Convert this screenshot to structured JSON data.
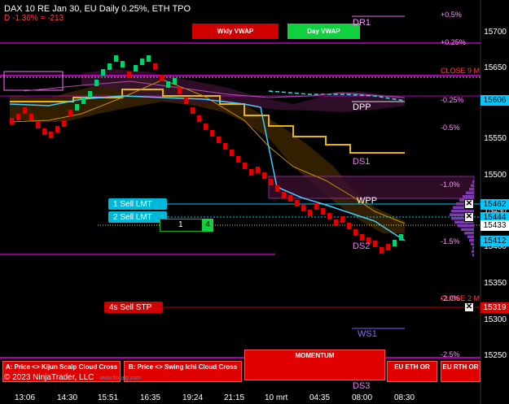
{
  "header": {
    "title": "DAX 10  RE Jan 30, EU Daily 0.25%, ETH TPO",
    "change": "D -1.36% = -213"
  },
  "vwap_buttons": {
    "weekly": "Wkly VWAP",
    "daily": "Day VWAP"
  },
  "level_labels": {
    "dr1": "DR1",
    "close_9m": "CLOSE 9 M",
    "dpp": "DPP",
    "ds1": "DS1",
    "wpp": "WPP",
    "ds2": "DS2",
    "ws1": "WS1",
    "close_2m": "CLOSE 2 M",
    "ds3": "DS3"
  },
  "pct_labels": {
    "p050": "+0.5%",
    "p025": "+0.25%",
    "m025": "-0.25%",
    "m050": "-0.5%",
    "m100": "-1.0%",
    "m150": "-1.5%",
    "m200": "-2.0%",
    "m250": "-2.5%"
  },
  "orders": {
    "sell_lmt_1": "1  Sell LMT",
    "sell_lmt_2": "2  Sell LMT",
    "sell_stp": "4s  Sell STP",
    "qty": "1",
    "qty_badge": "4"
  },
  "price_axis": [
    "15700",
    "15650",
    "15600",
    "15550",
    "15500",
    "15450",
    "15400",
    "15350",
    "15300",
    "15250"
  ],
  "price_tags": {
    "last": "15606",
    "sell_lmt_1": "15462",
    "sell_lmt_2": "15444",
    "current": "15433",
    "low": "15412",
    "stop": "15319"
  },
  "time_axis": [
    "13:06",
    "14:30",
    "15:51",
    "16:35",
    "19:24",
    "21:15",
    "10 mrt",
    "04:35",
    "08:00",
    "08:30"
  ],
  "bottom_buttons": {
    "a": "A: Price <> Kijun Scalp Cloud Cross",
    "b": "B: Price <> Swing Ichi Cloud Cross",
    "momentum": "MOMENTUM",
    "eu_eth": "EU ETH OR",
    "eu_rth": "EU RTH OR"
  },
  "copyright": "© 2023 NinjaTrader, LLC",
  "watermark": "www.fin-alg.com",
  "colors": {
    "bull": "#00d070",
    "bear": "#e00000",
    "magenta": "#e000e0",
    "cyan": "#00c8ff",
    "gold": "#e0b000",
    "cloud": "#3a2800"
  }
}
